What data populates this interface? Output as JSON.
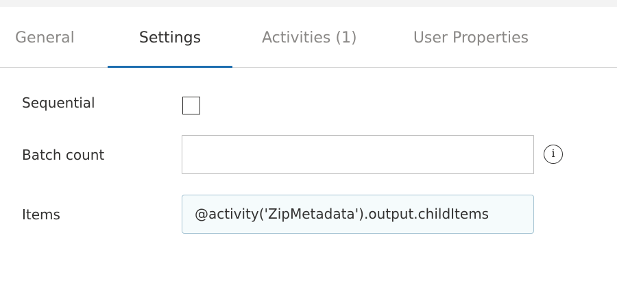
{
  "tabs": [
    {
      "label": "General",
      "active": false
    },
    {
      "label": "Settings",
      "active": true
    },
    {
      "label": "Activities (1)",
      "active": false
    },
    {
      "label": "User Properties",
      "active": false
    }
  ],
  "settings": {
    "sequential": {
      "label": "Sequential",
      "checked": false
    },
    "batch_count": {
      "label": "Batch count",
      "value": "",
      "info_icon": "info-icon"
    },
    "items": {
      "label": "Items",
      "value": "@activity('ZipMetadata').output.childItems"
    }
  },
  "colors": {
    "active_tab_underline": "#1f6fb0",
    "items_field_bg": "#f5fbfc"
  }
}
